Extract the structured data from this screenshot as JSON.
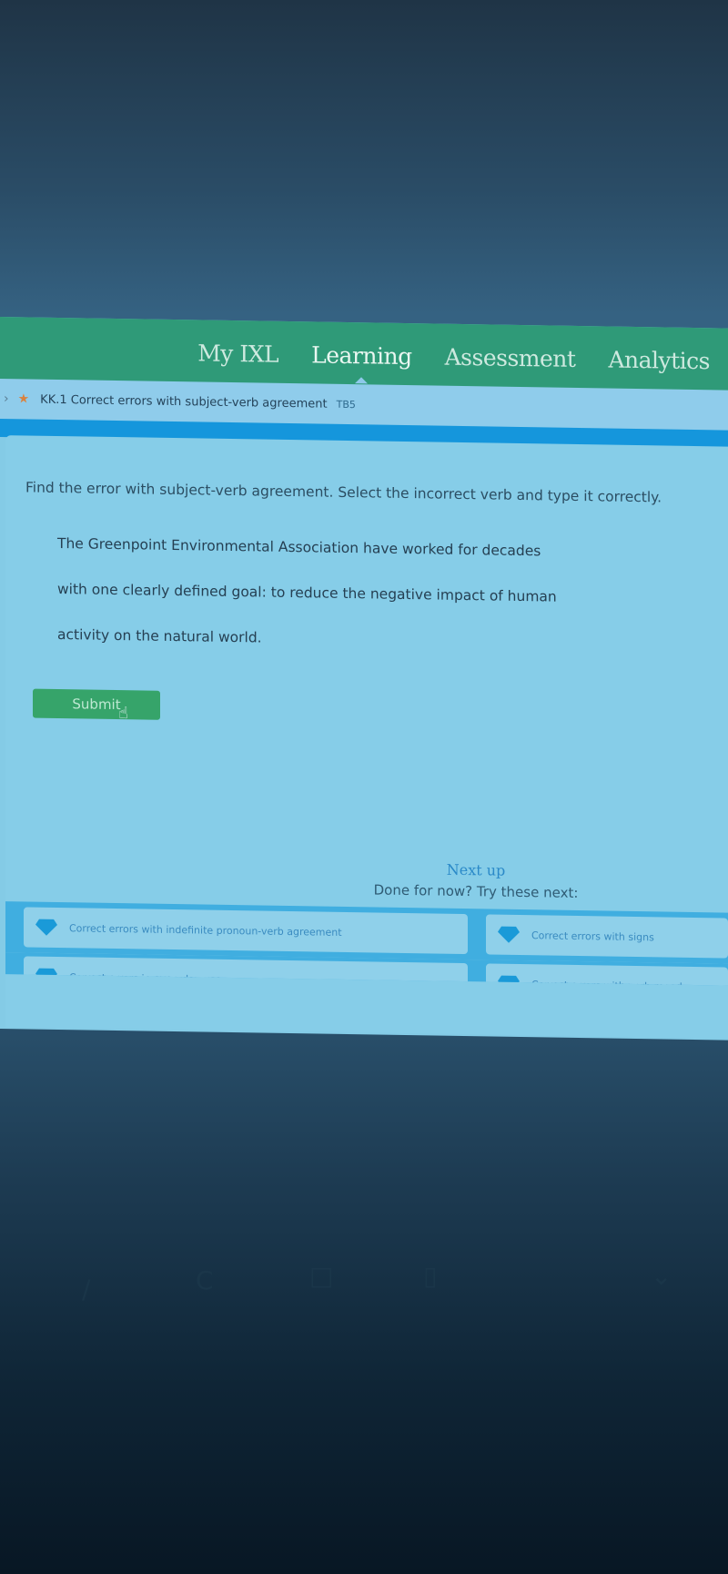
{
  "nav": {
    "items": [
      {
        "label": "My IXL",
        "active": false
      },
      {
        "label": "Learning",
        "active": true
      },
      {
        "label": "Assessment",
        "active": false
      },
      {
        "label": "Analytics",
        "active": false
      }
    ]
  },
  "breadcrumb": {
    "chevron_icon": "chevron-right-icon",
    "star_icon": "star-icon",
    "skill_label": "KK.1 Correct errors with subject-verb agreement",
    "skill_code": "TB5"
  },
  "question": {
    "instruction": "Find the error with subject-verb agreement. Select the incorrect verb and type it correctly.",
    "passage_lines": [
      "The Greenpoint Environmental Association have worked for decades",
      "with one clearly defined goal: to reduce the negative impact of human",
      "activity on the natural world."
    ],
    "submit_label": "Submit"
  },
  "next_up": {
    "title": "Next up",
    "subtitle": "Done for now? Try these next:",
    "items": [
      {
        "label": "Correct errors with indefinite pronoun-verb agreement",
        "icon": "gem-icon"
      },
      {
        "label": "Correct errors with signs",
        "icon": "gem-icon"
      },
      {
        "label": "Correct errors in everyday use",
        "icon": "gem-icon"
      },
      {
        "label": "Correct errors with verb mood",
        "icon": "gem-icon"
      }
    ]
  },
  "colors": {
    "nav_green": "#2f9a78",
    "accent_blue": "#1596dc",
    "submit_green": "#36a46a",
    "star_orange": "#d9823e"
  }
}
